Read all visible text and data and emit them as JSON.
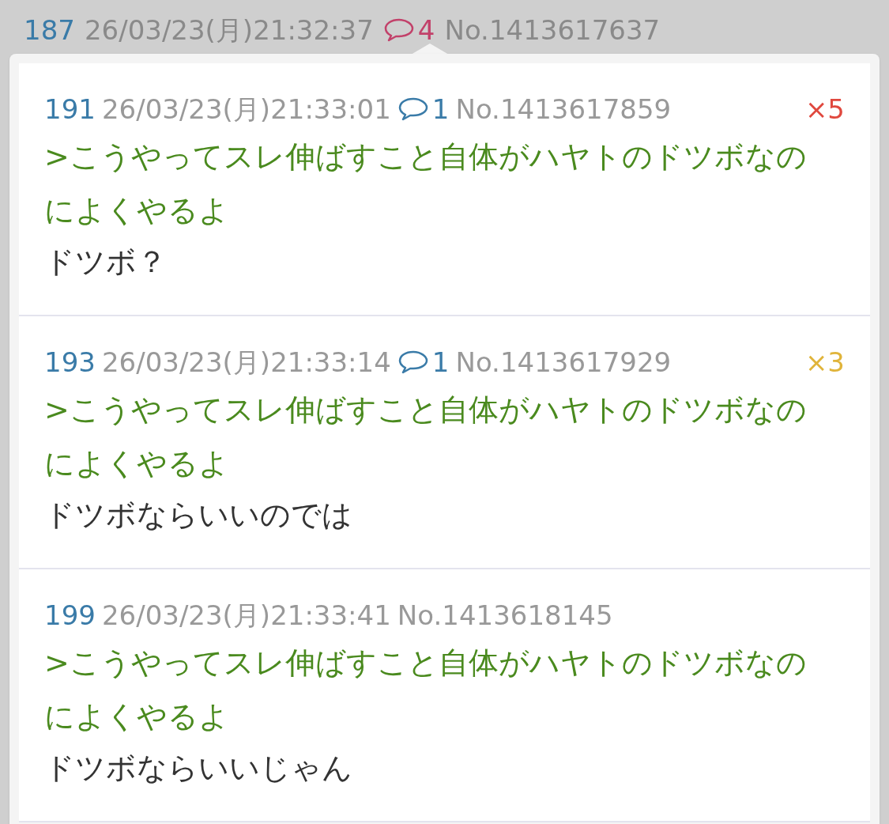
{
  "header": {
    "number": "187",
    "date": "26/03/23(月)21:32:37",
    "reply_count": "4",
    "post_no": "No.1413617637"
  },
  "posts": [
    {
      "number": "191",
      "date": "26/03/23(月)21:33:01",
      "reply_count": "1",
      "post_no": "No.1413617859",
      "badge": {
        "text": "×5",
        "color": "#e0483e"
      },
      "quote": ">こうやってスレ伸ばすこと自体がハヤトのドツボなのによくやるよ",
      "body": "ドツボ？"
    },
    {
      "number": "193",
      "date": "26/03/23(月)21:33:14",
      "reply_count": "1",
      "post_no": "No.1413617929",
      "badge": {
        "text": "×3",
        "color": "#e0b43a"
      },
      "quote": ">こうやってスレ伸ばすこと自体がハヤトのドツボなのによくやるよ",
      "body": "ドツボならいいのでは"
    },
    {
      "number": "199",
      "date": "26/03/23(月)21:33:41",
      "post_no": "No.1413618145",
      "quote": ">こうやってスレ伸ばすこと自体がハヤトのドツボなのによくやるよ",
      "body": "ドツボならいいじゃん"
    }
  ]
}
